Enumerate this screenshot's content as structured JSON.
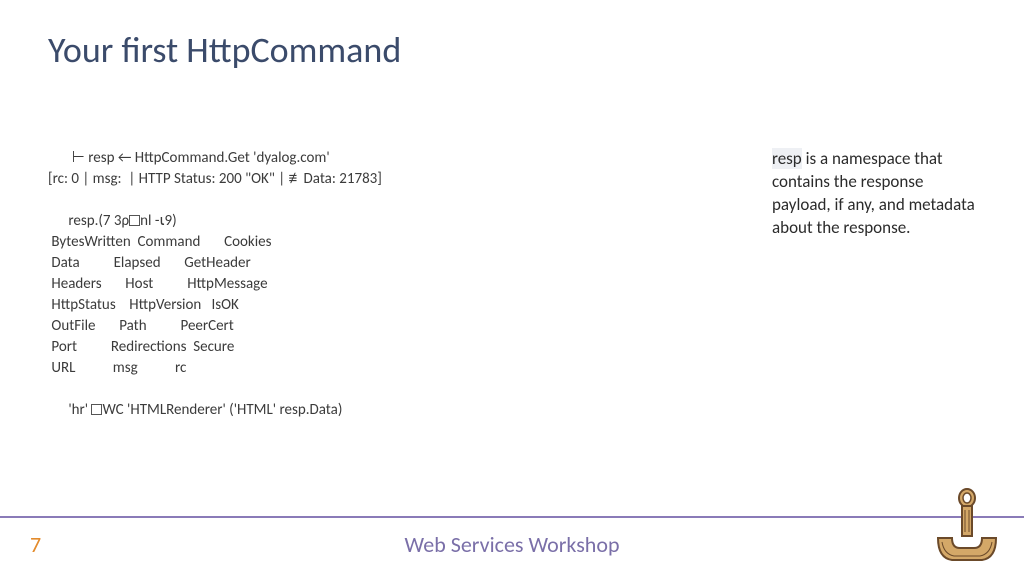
{
  "title": "Your first HttpCommand",
  "code": {
    "line1_indent": "       ",
    "line1": "⊢ resp ← HttpCommand.Get 'dyalog.com'",
    "line2": "[rc: 0 | msg:  | HTTP Status: 200 \"OK\" | ≢Data: 21783]",
    "line4_indent": "      ",
    "line4a": "resp.(7 3ρ",
    "line4b": "nl -⍳9)",
    "row1": " BytesWritten  Command       Cookies",
    "row2": " Data          Elapsed       GetHeader",
    "row3": " Headers       Host          HttpMessage",
    "row4": " HttpStatus    HttpVersion   IsOK",
    "row5": " OutFile       Path          PeerCert",
    "row6": " Port          Redirections  Secure",
    "row7": " URL           msg           rc",
    "line12_indent": "      ",
    "line12a": "'hr' ",
    "line12b": "WC 'HTMLRenderer' ('HTML' resp.Data)"
  },
  "note": {
    "t1": "resp",
    "t2": " is a namespace that contains the response payload, if any, and metadata about the response."
  },
  "footer": {
    "page": "7",
    "title": "Web Services Workshop"
  }
}
